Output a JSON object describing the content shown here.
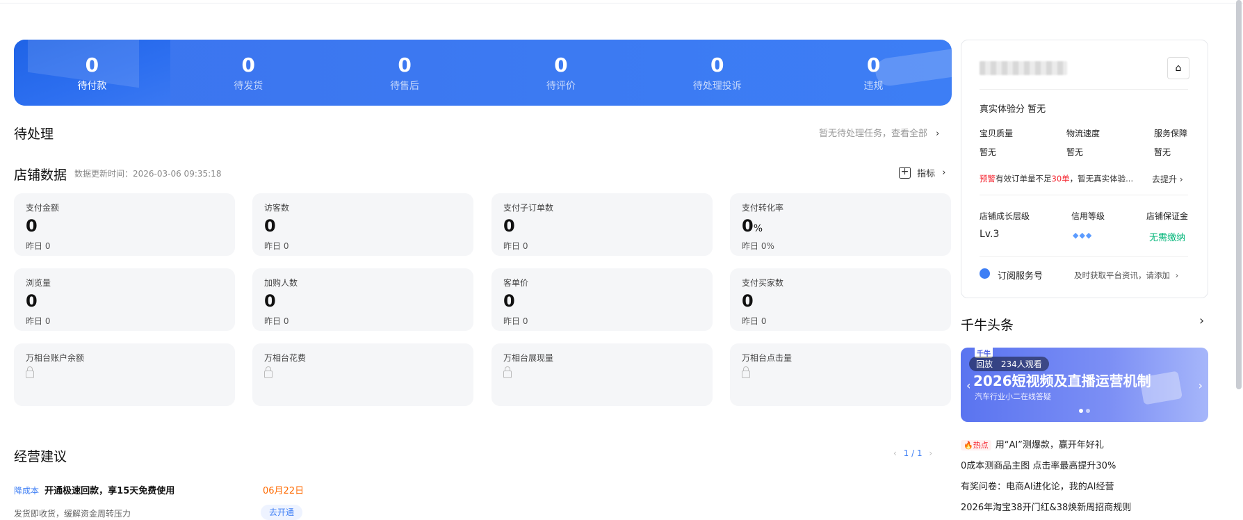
{
  "banner": {
    "stats": [
      {
        "value": "0",
        "label": "待付款"
      },
      {
        "value": "0",
        "label": "待发货"
      },
      {
        "value": "0",
        "label": "待售后"
      },
      {
        "value": "0",
        "label": "待评价"
      },
      {
        "value": "0",
        "label": "待处理投诉"
      },
      {
        "value": "0",
        "label": "违规"
      }
    ]
  },
  "todo": {
    "title": "待处理",
    "right_text": "暂无待处理任务，查看全部"
  },
  "shop_data": {
    "title": "店铺数据",
    "update_time": "数据更新时间：2026-03-06 09:35:18",
    "metrics_label": "指标",
    "cards": [
      {
        "title": "支付金额",
        "value": "0",
        "unit": "",
        "yesterday": "昨日 0"
      },
      {
        "title": "访客数",
        "value": "0",
        "unit": "",
        "yesterday": "昨日 0"
      },
      {
        "title": "支付子订单数",
        "value": "0",
        "unit": "",
        "yesterday": "昨日 0"
      },
      {
        "title": "支付转化率",
        "value": "0",
        "unit": "%",
        "yesterday": "昨日 0%"
      },
      {
        "title": "浏览量",
        "value": "0",
        "unit": "",
        "yesterday": "昨日 0"
      },
      {
        "title": "加购人数",
        "value": "0",
        "unit": "",
        "yesterday": "昨日 0"
      },
      {
        "title": "客单价",
        "value": "0",
        "unit": "",
        "yesterday": "昨日 0"
      },
      {
        "title": "支付买家数",
        "value": "0",
        "unit": "",
        "yesterday": "昨日 0"
      },
      {
        "title": "万相台账户余额"
      },
      {
        "title": "万相台花费"
      },
      {
        "title": "万相台展现量"
      },
      {
        "title": "万相台点击量"
      }
    ]
  },
  "advice": {
    "title": "经营建议",
    "pager": "1 / 1",
    "item": {
      "tag": "降成本",
      "headline": "开通极速回款，享15天免费使用",
      "date": "06月22日",
      "desc": "发货即收货，缓解资金周转压力",
      "button": "去开通"
    }
  },
  "panel": {
    "experience_label": "真实体验分",
    "experience_value": "暂无",
    "metrics": [
      {
        "label": "宝贝质量",
        "value": "暂无"
      },
      {
        "label": "物流速度",
        "value": "暂无"
      },
      {
        "label": "服务保障",
        "value": "暂无"
      }
    ],
    "warning_tag": "预警",
    "warning_pre": "有效订单量不足",
    "warning_num": "30单",
    "warning_post": "，暂无真实体验...",
    "improve": "去提升",
    "level_labels": [
      "店铺成长层级",
      "信用等级",
      "店铺保证金"
    ],
    "level_value": "Lv.3",
    "deposit_value": "无需缴纳",
    "subscribe_label": "订阅服务号",
    "subscribe_desc": "及时获取平台资讯，请添加"
  },
  "headlines": {
    "title": "千牛头条",
    "banner": {
      "badge": "回放",
      "viewers": "234人观看",
      "title": "2026短视频及直播运营机制",
      "subtitle": "汽车行业小二在线答疑",
      "logo": "千牛"
    },
    "hot_tag": "热点",
    "items": [
      "用“AI”测爆款，赢开年好礼",
      "0成本测商品主图 点击率最高提升30%",
      "有奖问卷：电商AI进化论，我的AI经营",
      "2026年淘宝38开门红&38焕新周招商规则"
    ]
  },
  "colors": {
    "primary": "#3d7ef5",
    "warning": "#f5222d",
    "orange": "#ff6a00",
    "green": "#00b578"
  }
}
